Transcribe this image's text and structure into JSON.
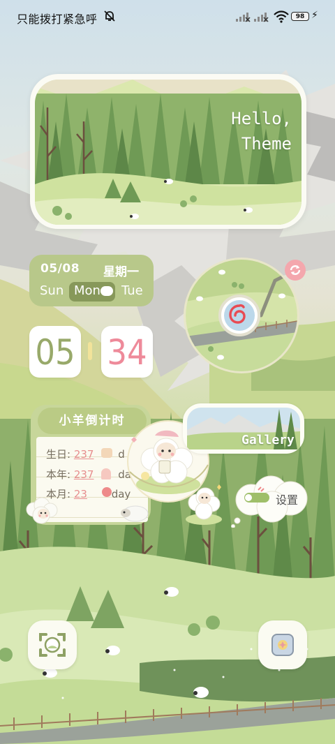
{
  "status_bar": {
    "carrier": "只能拨打紧急呼",
    "battery": "98"
  },
  "hello_widget": {
    "line1": "Hello,",
    "line2": "Theme"
  },
  "date_widget": {
    "date": "05/08",
    "weekday": "星期一",
    "prev_day": "Sun",
    "current_day": "Mon",
    "next_day": "Tue"
  },
  "clock": {
    "hour": "05",
    "minute": "34"
  },
  "countdown": {
    "title": "小羊倒计时",
    "rows": [
      {
        "label": "生日:",
        "value": "237",
        "suffix": "d"
      },
      {
        "label": "本年:",
        "value": "237",
        "suffix": "da"
      },
      {
        "label": "本月:",
        "value": "23",
        "suffix": "day"
      }
    ]
  },
  "gallery": {
    "label": "Gallery"
  },
  "settings": {
    "label": "设置"
  },
  "colors": {
    "accent_green": "#b8c88a",
    "clock_hour": "#98a96a",
    "clock_minute": "#ee8a9a",
    "countdown_value": "#e78f8f"
  },
  "icons": [
    "muted-bell-icon",
    "signal-icon",
    "wifi-icon",
    "battery-icon",
    "charging-icon",
    "netease-music-icon",
    "refresh-icon",
    "camera-scan-icon",
    "theme-store-icon"
  ]
}
